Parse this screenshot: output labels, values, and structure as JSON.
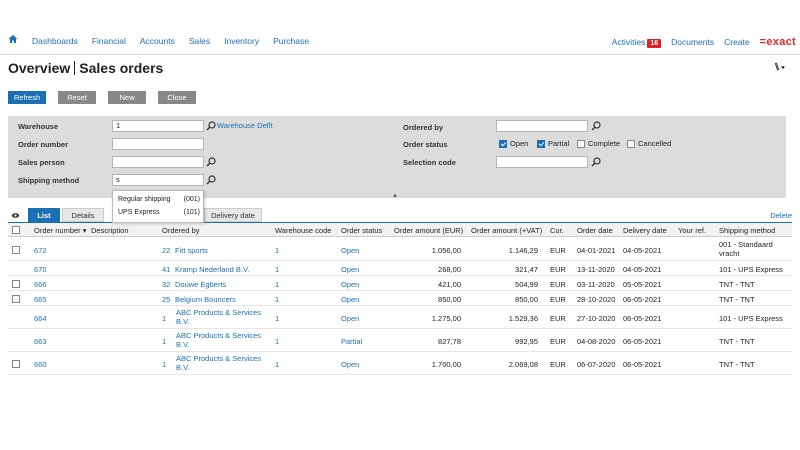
{
  "nav": {
    "left": [
      "Dashboards",
      "Financial",
      "Accounts",
      "Sales",
      "Inventory",
      "Purchase"
    ],
    "activities_label": "Activities",
    "activities_count": "16",
    "documents": "Documents",
    "create": "Create",
    "logo": "=exact"
  },
  "page": {
    "title_part1": "Overview",
    "title_part2": "Sales orders",
    "settings": "⑊▾"
  },
  "buttons": {
    "refresh": "Refresh",
    "reset": "Reset",
    "new": "New",
    "close": "Close"
  },
  "filters": {
    "warehouse_label": "Warehouse",
    "warehouse_value": "1",
    "warehouse_name": "Warehouse Delft",
    "order_number_label": "Order number",
    "sales_person_label": "Sales person",
    "shipping_method_label": "Shipping method",
    "shipping_method_value": "s",
    "ordered_by_label": "Ordered by",
    "order_status_label": "Order status",
    "selection_code_label": "Selection code",
    "status_open": "Open",
    "status_partial": "Partial",
    "status_complete": "Complete",
    "status_cancelled": "Cancelled"
  },
  "dropdown": [
    {
      "name": "Regular shipping",
      "code": "(001)"
    },
    {
      "name": "UPS Express",
      "code": "(101)"
    }
  ],
  "tabs": {
    "list": "List",
    "details": "Details",
    "delivery_date": "Delivery date",
    "delete": "Delete"
  },
  "table": {
    "headers": {
      "order_number": "Order number ▾",
      "description": "Description",
      "ordered_by": "Ordered by",
      "warehouse_code": "Warehouse code",
      "order_status": "Order status",
      "order_amount": "Order amount (EUR)",
      "order_amount_vat": "Order amount (+VAT)",
      "cur": "Cur.",
      "order_date": "Order date",
      "delivery_date": "Delivery date",
      "your_ref": "Your ref.",
      "shipping_method": "Shipping method"
    },
    "rows": [
      {
        "num": "672",
        "cust_code": "22",
        "cust": "Fitt sports",
        "cust2": "",
        "wh": "1",
        "status": "Open",
        "amt": "1.056,00",
        "vat": "1.146,29",
        "cur": "EUR",
        "odate": "04-01-2021",
        "ddate": "04-05-2021",
        "ship": "001 - Standaard",
        "ship2": "vracht"
      },
      {
        "num": "670",
        "cust_code": "41",
        "cust": "Kramp Nederland B.V.",
        "cust2": "",
        "wh": "1",
        "status": "Open",
        "amt": "268,00",
        "vat": "321,47",
        "cur": "EUR",
        "odate": "13-11-2020",
        "ddate": "04-05-2021",
        "ship": "101 - UPS Express",
        "ship2": ""
      },
      {
        "num": "666",
        "cust_code": "32",
        "cust": "Douwe Egberts",
        "cust2": "",
        "wh": "1",
        "status": "Open",
        "amt": "421,00",
        "vat": "504,99",
        "cur": "EUR",
        "odate": "03-11-2020",
        "ddate": "05-05-2021",
        "ship": "TNT - TNT",
        "ship2": ""
      },
      {
        "num": "665",
        "cust_code": "25",
        "cust": "Belgium Bouncers",
        "cust2": "",
        "wh": "1",
        "status": "Open",
        "amt": "850,00",
        "vat": "850,00",
        "cur": "EUR",
        "odate": "28-10-2020",
        "ddate": "06-05-2021",
        "ship": "TNT - TNT",
        "ship2": ""
      },
      {
        "num": "664",
        "cust_code": "1",
        "cust": "ABC Products & Services",
        "cust2": "B.V.",
        "wh": "1",
        "status": "Open",
        "amt": "1.275,00",
        "vat": "1.529,36",
        "cur": "EUR",
        "odate": "27-10-2020",
        "ddate": "06-05-2021",
        "ship": "101 - UPS Express",
        "ship2": ""
      },
      {
        "num": "663",
        "cust_code": "1",
        "cust": "ABC Products & Services",
        "cust2": "B.V.",
        "wh": "1",
        "status": "Partial",
        "amt": "827,78",
        "vat": "992,95",
        "cur": "EUR",
        "odate": "04-08-2020",
        "ddate": "06-05-2021",
        "ship": "TNT - TNT",
        "ship2": ""
      },
      {
        "num": "660",
        "cust_code": "1",
        "cust": "ABC Products & Services",
        "cust2": "B.V.",
        "wh": "1",
        "status": "Open",
        "amt": "1.700,00",
        "vat": "2.069,08",
        "cur": "EUR",
        "odate": "06-07-2020",
        "ddate": "06-05-2021",
        "ship": "TNT - TNT",
        "ship2": ""
      }
    ]
  }
}
